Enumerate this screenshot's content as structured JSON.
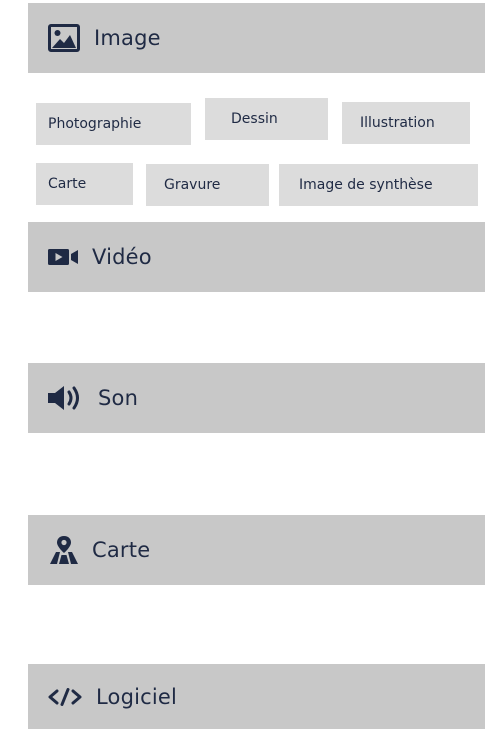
{
  "sections": {
    "image": {
      "label": "Image",
      "icon": "image-icon"
    },
    "video": {
      "label": "Vidéo",
      "icon": "video-camera-icon"
    },
    "son": {
      "label": "Son",
      "icon": "speaker-icon"
    },
    "carte": {
      "label": "Carte",
      "icon": "map-pin-icon"
    },
    "logiciel": {
      "label": "Logiciel",
      "icon": "code-icon"
    }
  },
  "image_types": [
    "Photographie",
    "Dessin",
    "Illustration",
    "Carte",
    "Gravure",
    "Image de synthèse"
  ],
  "colors": {
    "section_bg": "#c8c8c8",
    "chip_bg": "#dcdcdc",
    "text": "#1f2a44"
  }
}
